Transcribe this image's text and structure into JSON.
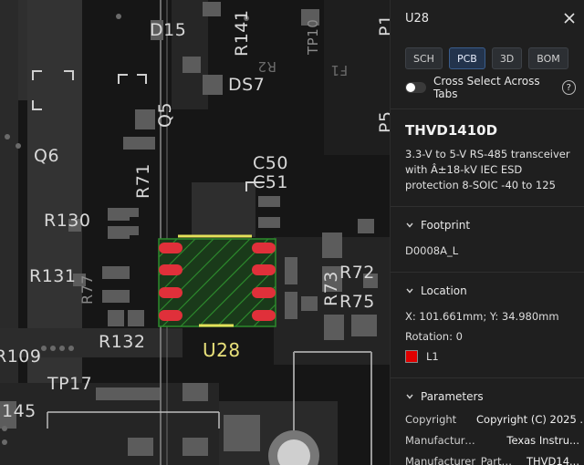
{
  "pcb": {
    "labels": {
      "d15": "D15",
      "r141": "R141",
      "tp10": "TP10",
      "p1": "P1",
      "ds7": "DS7",
      "r2": "R2",
      "f1": "F1",
      "p5": "P5",
      "q6": "Q6",
      "q5": "Q5",
      "r71": "R71",
      "c50": "C50",
      "c51": "C51",
      "r130": "R130",
      "r131": "R131",
      "r77": "R77",
      "r72": "R72",
      "r73": "R73",
      "r75": "R75",
      "r132": "R132",
      "u28": "U28",
      "r109": "R109",
      "tp17": "TP17",
      "r145": "145"
    }
  },
  "panel": {
    "title": "U28",
    "tabs": [
      "SCH",
      "PCB",
      "3D",
      "BOM"
    ],
    "cross_select_label": "Cross Select Across Tabs",
    "help_glyph": "?",
    "part_name": "THVD1410D",
    "part_description": "3.3-V to 5-V RS-485 transceiver with Â±18-kV IEC ESD protection 8-SOIC -40 to 125",
    "footprint": {
      "heading": "Footprint",
      "value": "D0008A_L"
    },
    "location": {
      "heading": "Location",
      "coords": "X: 101.661mm; Y: 34.980mm",
      "rotation": "Rotation: 0",
      "layer": "L1",
      "layer_color": "#e00000"
    },
    "parameters": {
      "heading": "Parameters",
      "rows": [
        {
          "key": "Copyright",
          "value": "Copyright (C) 2025 ..."
        },
        {
          "key": "Manufacturer_...",
          "value": "Texas Instru..."
        },
        {
          "key": "Manufacturer_Part_N...",
          "value": "THVD14..."
        }
      ]
    }
  }
}
